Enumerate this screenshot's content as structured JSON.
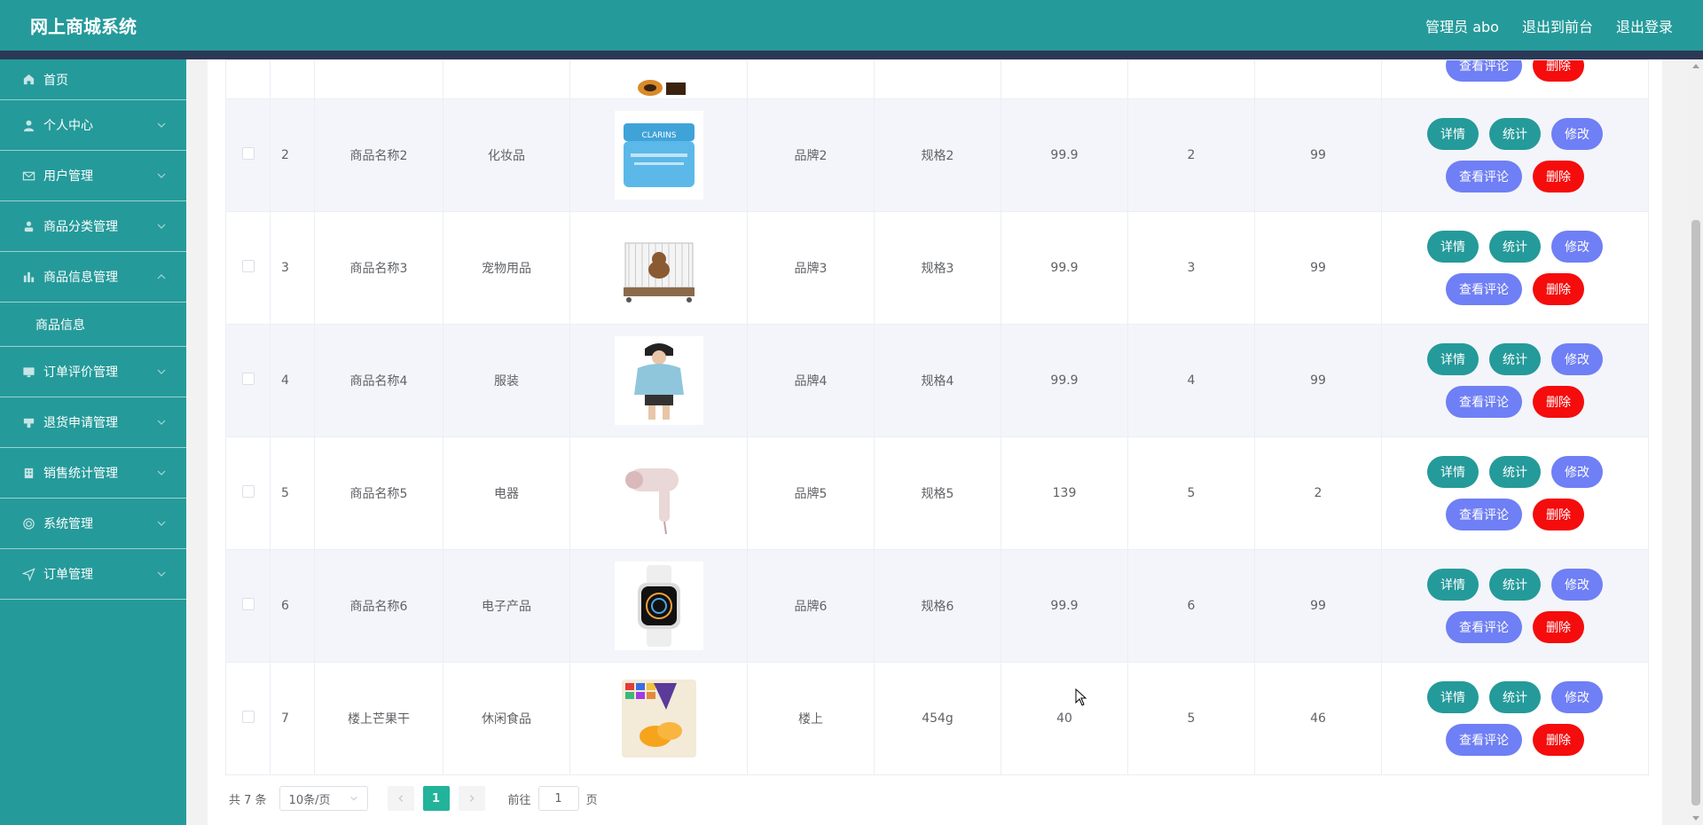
{
  "header": {
    "title": "网上商城系统",
    "admin": "管理员 abo",
    "to_front": "退出到前台",
    "logout": "退出登录"
  },
  "sidebar": {
    "items": [
      {
        "label": "首页",
        "icon": "home-icon"
      },
      {
        "label": "个人中心",
        "icon": "user-icon"
      },
      {
        "label": "用户管理",
        "icon": "mail-icon"
      },
      {
        "label": "商品分类管理",
        "icon": "person-icon"
      },
      {
        "label": "商品信息管理",
        "icon": "chart-icon"
      },
      {
        "label": "订单评价管理",
        "icon": "monitor-icon"
      },
      {
        "label": "退货申请管理",
        "icon": "box-icon"
      },
      {
        "label": "销售统计管理",
        "icon": "building-icon"
      },
      {
        "label": "系统管理",
        "icon": "globe-icon"
      },
      {
        "label": "订单管理",
        "icon": "send-icon"
      }
    ],
    "submenu": "商品信息"
  },
  "buttons": {
    "detail": "详情",
    "stats": "统计",
    "edit": "修改",
    "review": "查看评论",
    "delete": "删除"
  },
  "rows": [
    {
      "id": "2",
      "name": "商品名称2",
      "category": "化妆品",
      "brand": "品牌2",
      "spec": "规格2",
      "price": "99.9",
      "sales": "2",
      "stock": "99",
      "img": "cream"
    },
    {
      "id": "3",
      "name": "商品名称3",
      "category": "宠物用品",
      "brand": "品牌3",
      "spec": "规格3",
      "price": "99.9",
      "sales": "3",
      "stock": "99",
      "img": "petcage"
    },
    {
      "id": "4",
      "name": "商品名称4",
      "category": "服装",
      "brand": "品牌4",
      "spec": "规格4",
      "price": "99.9",
      "sales": "4",
      "stock": "99",
      "img": "hoodie"
    },
    {
      "id": "5",
      "name": "商品名称5",
      "category": "电器",
      "brand": "品牌5",
      "spec": "规格5",
      "price": "139",
      "sales": "5",
      "stock": "2",
      "img": "hairdryer"
    },
    {
      "id": "6",
      "name": "商品名称6",
      "category": "电子产品",
      "brand": "品牌6",
      "spec": "规格6",
      "price": "99.9",
      "sales": "6",
      "stock": "99",
      "img": "watch"
    },
    {
      "id": "7",
      "name": "楼上芒果干",
      "category": "休闲食品",
      "brand": "楼上",
      "spec": "454g",
      "price": "40",
      "sales": "5",
      "stock": "46",
      "img": "mango"
    }
  ],
  "pager": {
    "total": "共 7 条",
    "size": "10条/页",
    "page": "1",
    "goto": "前往",
    "goto_value": "1",
    "unit": "页"
  },
  "colors": {
    "primary": "#259a9a",
    "header_band": "#2b3956",
    "button_blue": "#6f7ff5",
    "button_red": "#f50c0c",
    "page_active": "#22b39b"
  }
}
